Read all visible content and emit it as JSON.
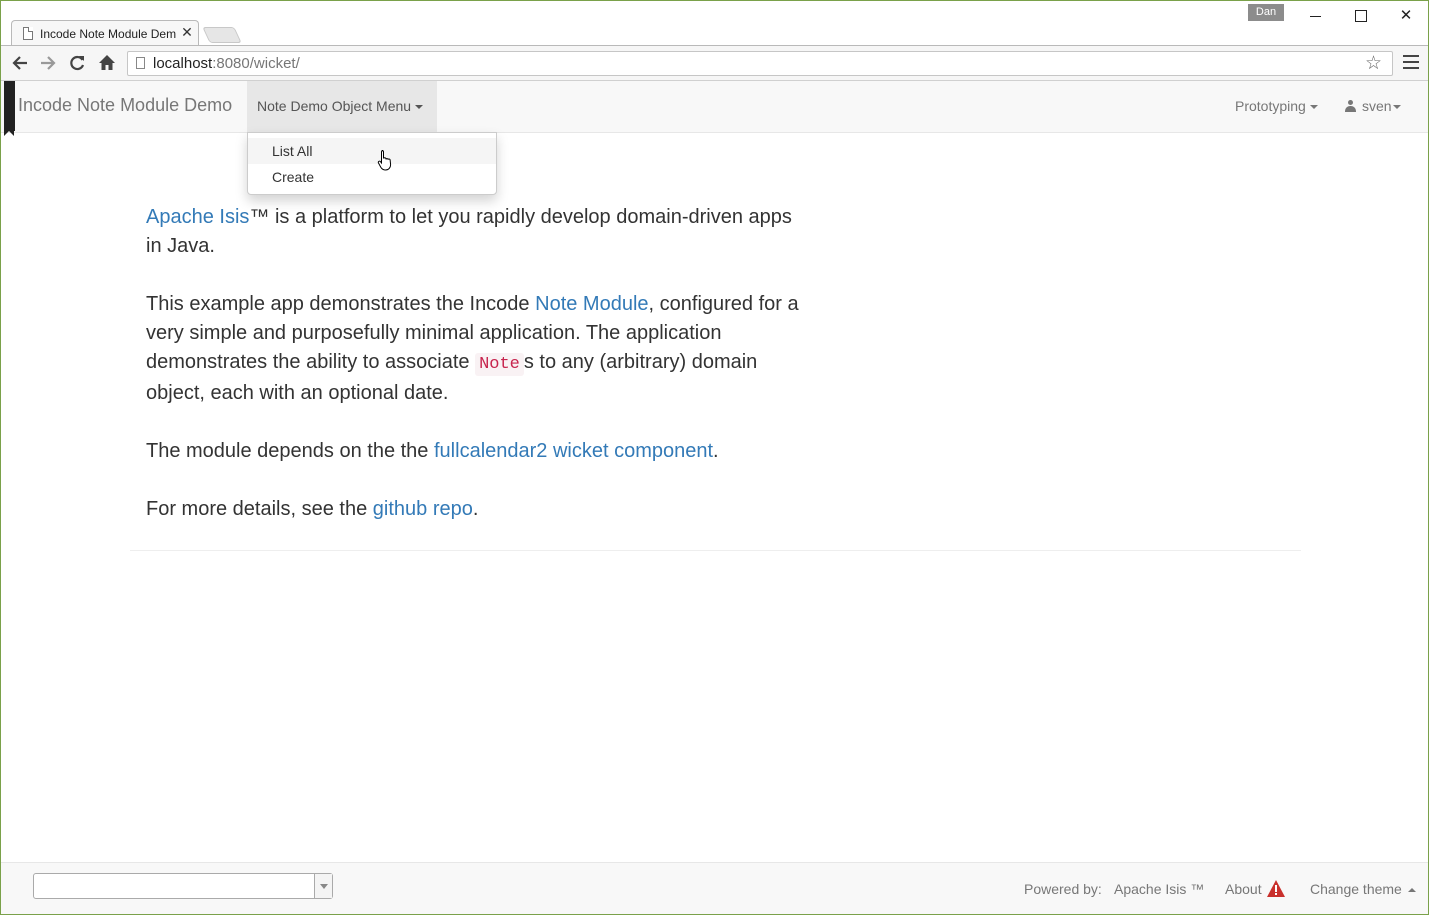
{
  "browser": {
    "tab_title": "Incode Note Module Dem",
    "tab_close": "✕",
    "user_badge": "Dan",
    "url_host": "localhost",
    "url_path": ":8080/wicket/"
  },
  "navbar": {
    "brand": "Incode Note Module Demo",
    "object_menu_label": "Note Demo Object Menu",
    "prototyping_label": "Prototyping",
    "user_label": "sven"
  },
  "dropdown": {
    "items": [
      {
        "label": "List All"
      },
      {
        "label": "Create"
      }
    ]
  },
  "content": {
    "p1": {
      "link": "Apache Isis",
      "text": "™ is a platform to let you rapidly develop domain-driven apps in Java."
    },
    "p2": {
      "before": "This example app demonstrates the Incode ",
      "link": "Note Module",
      "middle": ", configured for a very simple and purposefully minimal application. The application demonstrates the ability to associate ",
      "code": "Note",
      "after": "s to any (arbitrary) domain object, each with an optional date."
    },
    "p3": {
      "before": "The module depends on the the ",
      "link": "fullcalendar2 wicket component",
      "after": "."
    },
    "p4": {
      "before": "For more details, see the ",
      "link": "github repo",
      "after": "."
    }
  },
  "footer": {
    "powered_by": "Powered by:",
    "isis_link": "Apache Isis ™",
    "about_link": "About",
    "change_theme": "Change theme"
  },
  "colors": {
    "link": "#337ab7",
    "navbar_bg": "#f8f8f8",
    "warning": "#c9302c"
  }
}
